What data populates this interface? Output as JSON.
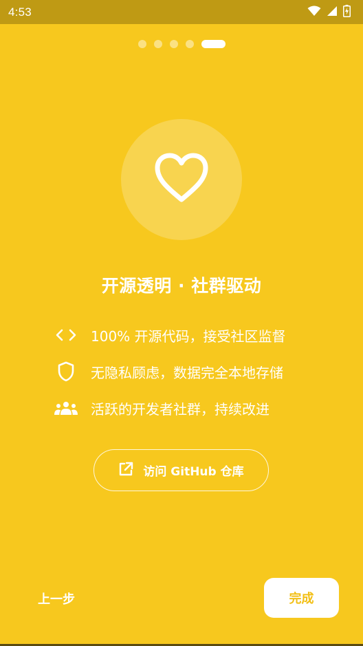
{
  "status_bar": {
    "time": "4:53",
    "icons": [
      "wifi-icon",
      "cellular-signal-icon",
      "battery-charging-icon"
    ]
  },
  "pager": {
    "total_pages": 5,
    "current_page": 5
  },
  "hero": {
    "icon": "heart-icon",
    "title": "开源透明 · 社群驱动"
  },
  "features": [
    {
      "icon": "code-brackets-icon",
      "text": "100% 开源代码，接受社区监督"
    },
    {
      "icon": "shield-icon",
      "text": "无隐私顾虑，数据完全本地存储"
    },
    {
      "icon": "group-icon",
      "text": "活跃的开发者社群，持续改进"
    }
  ],
  "github_button": {
    "icon": "external-link-icon",
    "label": "访问 GitHub 仓库"
  },
  "navigation": {
    "prev_label": "上一步",
    "finish_label": "完成"
  },
  "colors": {
    "background": "#F7C81E",
    "status_bar": "#BF9A14",
    "accent_text": "#F2BF16",
    "foreground": "#FFFFFF"
  }
}
